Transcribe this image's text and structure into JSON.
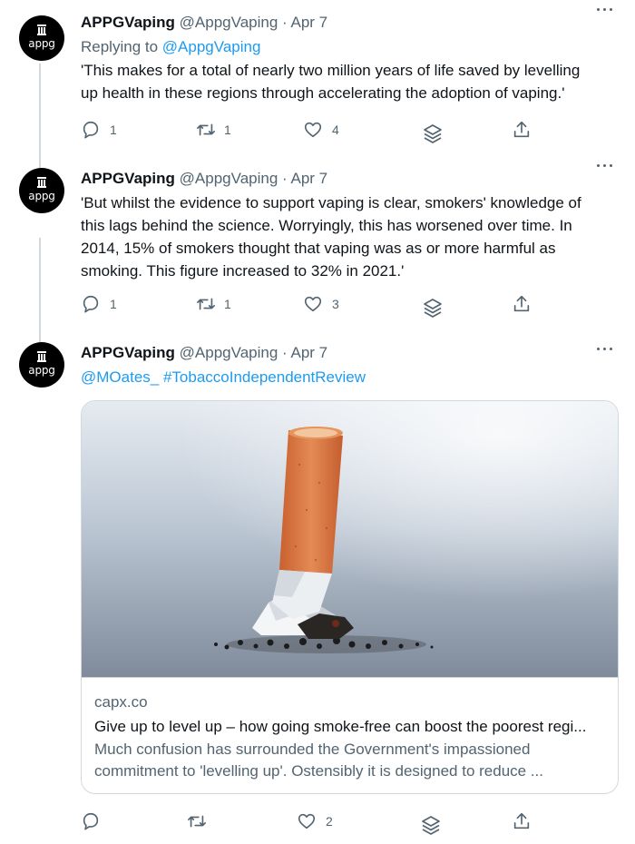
{
  "tweets": [
    {
      "avatar_text": "appg",
      "name": "APPGVaping",
      "handle": "@AppgVaping",
      "separator": "·",
      "date": "Apr 7",
      "replying_prefix": "Replying to ",
      "replying_handle": "@AppgVaping",
      "lines": [
        "'This makes for a total of nearly two million years of life saved by levelling",
        "up health in these regions through accelerating the adoption of vaping.'"
      ],
      "replies": "1",
      "retweets": "1",
      "likes": "4"
    },
    {
      "avatar_text": "appg",
      "name": "APPGVaping",
      "handle": "@AppgVaping",
      "separator": "·",
      "date": "Apr 7",
      "lines": [
        "'But whilst the evidence to support vaping is clear, smokers' knowledge of",
        "this lags behind the science. Worryingly, this has worsened over time. In",
        "2014, 15% of smokers thought that vaping was as or more harmful as",
        "smoking. This figure increased to 32% in 2021.'"
      ],
      "replies": "1",
      "retweets": "1",
      "likes": "3"
    },
    {
      "avatar_text": "appg",
      "name": "APPGVaping",
      "handle": "@AppgVaping",
      "separator": "·",
      "date": "Apr 7",
      "mention": "@MOates_",
      "hashtag": "#TobaccoIndependentReview",
      "card": {
        "domain": "capx.co",
        "title": "Give up to level up – how going smoke-free can boost the poorest regi...",
        "description_lines": [
          "Much confusion has surrounded the Government's impassioned",
          "commitment to 'levelling up'. Ostensibly it is designed to reduce ..."
        ]
      },
      "likes": "2"
    }
  ],
  "colors": {
    "accent": "#1d9bf0",
    "text": "#0f1419",
    "muted": "#536471",
    "border": "#cfd9de"
  },
  "icons": [
    "more-icon",
    "reply-icon",
    "retweet-icon",
    "like-icon",
    "stack-icon",
    "share-icon",
    "building-icon"
  ]
}
